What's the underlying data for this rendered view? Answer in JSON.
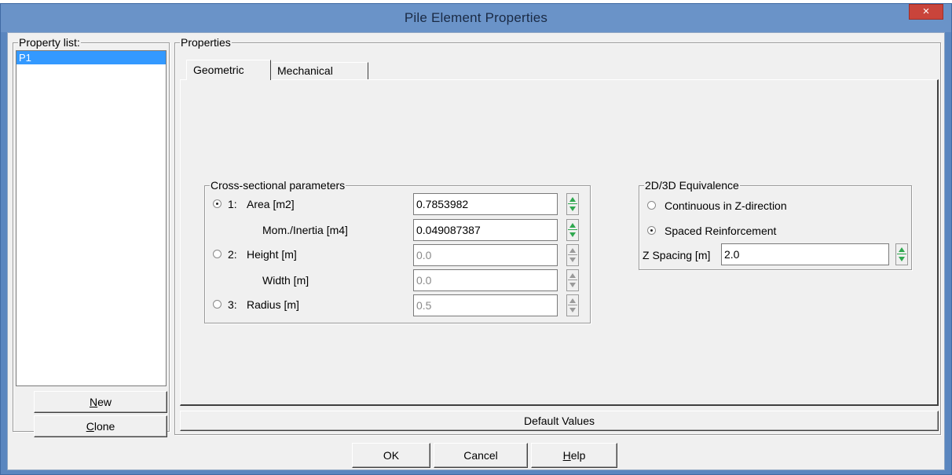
{
  "window": {
    "title": "Pile Element Properties",
    "close_glyph": "×"
  },
  "property_list": {
    "label": "Property list:",
    "items": [
      {
        "label": "P1",
        "selected": true
      }
    ],
    "new_button": {
      "prefix": "",
      "mnemonic": "N",
      "suffix": "ew"
    },
    "clone_button": {
      "prefix": "",
      "mnemonic": "C",
      "suffix": "lone"
    }
  },
  "properties": {
    "label": "Properties",
    "tabs": [
      {
        "label": "Geometric",
        "active": true
      },
      {
        "label": "Mechanical",
        "active": false
      }
    ],
    "cross_section": {
      "label": "Cross-sectional parameters",
      "rows": [
        {
          "radio_label": "1:",
          "name": "Area [m2]",
          "value": "0.7853982",
          "enabled": true,
          "radio_checked": true
        },
        {
          "radio_label": "",
          "name": "Mom./Inertia [m4]",
          "value": "0.049087387",
          "enabled": true
        },
        {
          "radio_label": "2:",
          "name": "Height [m]",
          "value": "0.0",
          "enabled": false,
          "radio_checked": false
        },
        {
          "radio_label": "",
          "name": "Width [m]",
          "value": "0.0",
          "enabled": false
        },
        {
          "radio_label": "3:",
          "name": "Radius [m]",
          "value": "0.5",
          "enabled": false,
          "radio_checked": false
        }
      ]
    },
    "equivalence": {
      "label": "2D/3D Equivalence",
      "options": [
        {
          "label": "Continuous in Z-direction",
          "checked": false
        },
        {
          "label": "Spaced Reinforcement",
          "checked": true
        }
      ],
      "z_spacing_label": "Z Spacing [m]",
      "z_spacing_value": "2.0"
    },
    "default_values_button": "Default Values"
  },
  "footer": {
    "ok": "OK",
    "cancel": "Cancel",
    "help": {
      "prefix": "",
      "mnemonic": "H",
      "suffix": "elp"
    }
  },
  "colors": {
    "title_bar": "#6a93c8",
    "close_button": "#c9443b",
    "selection": "#3399ff",
    "spinner_arrow": "#2fa84f",
    "dialog_bg": "#f0f0f0"
  }
}
